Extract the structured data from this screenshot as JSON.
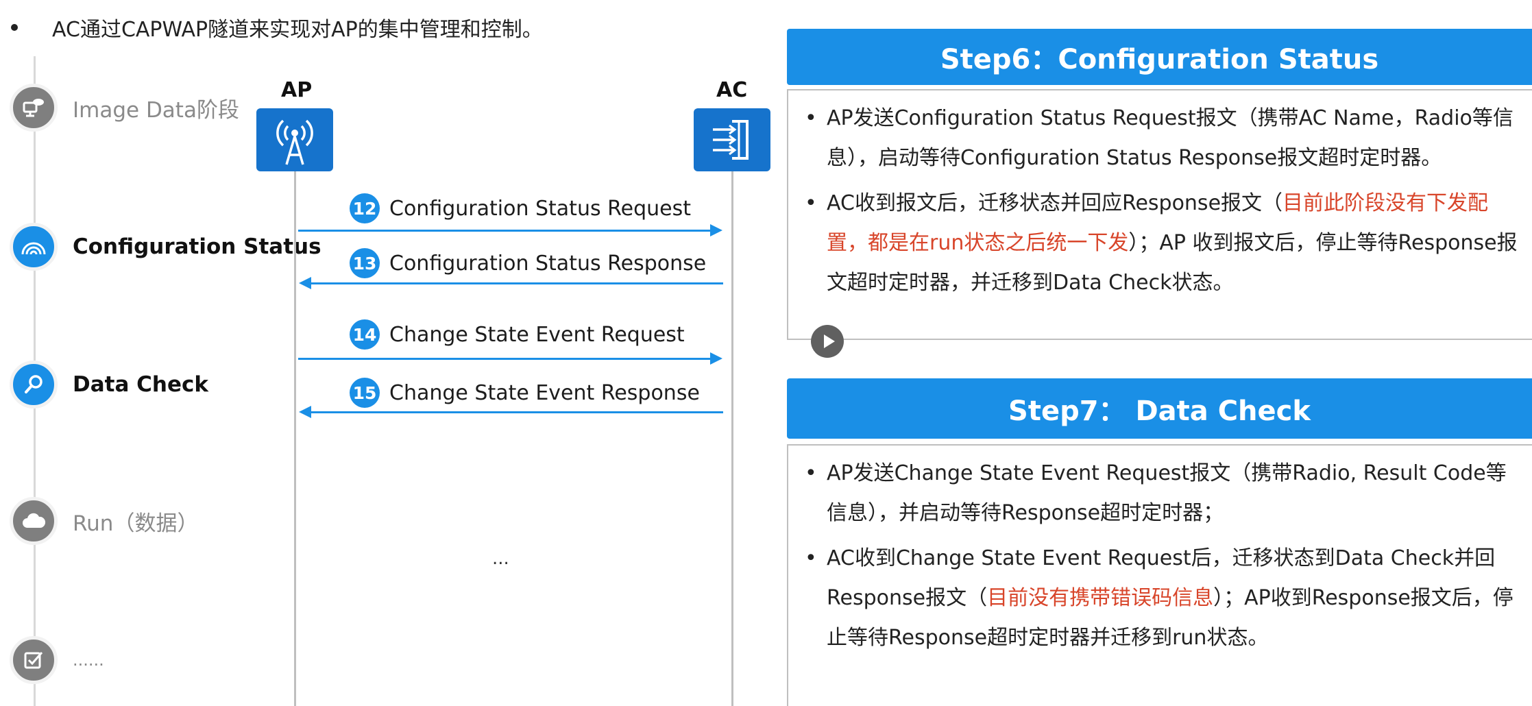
{
  "intro": "AC通过CAPWAP隧道来实现对AP的集中管理和控制。",
  "stages": [
    {
      "label": "Image Data阶段",
      "icon": "image-data-icon"
    },
    {
      "label": "Configuration Status",
      "icon": "rainbow-icon"
    },
    {
      "label": "Data Check",
      "icon": "magnifier-icon"
    },
    {
      "label": "Run（数据）",
      "icon": "cloud-icon"
    },
    {
      "label": "......",
      "icon": "checkbox-icon"
    }
  ],
  "nodes": {
    "ap": "AP",
    "ac": "AC"
  },
  "messages": [
    {
      "num": "12",
      "text": "Configuration Status Request",
      "direction": "right"
    },
    {
      "num": "13",
      "text": "Configuration Status Response",
      "direction": "left"
    },
    {
      "num": "14",
      "text": "Change State Event Request",
      "direction": "right"
    },
    {
      "num": "15",
      "text": "Change State Event Response",
      "direction": "left"
    }
  ],
  "mid_ellipsis": "...",
  "step6": {
    "title": "Step6：Configuration Status",
    "b1": "AP发送Configuration Status Request报文（携带AC Name，Radio等信息），启动等待Configuration Status Response报文超时定时器。",
    "b2_pre": "AC收到报文后，迁移状态并回应Response报文（",
    "b2_red": "目前此阶段没有下发配置，都是在run状态之后统一下发",
    "b2_post": "）；AP 收到报文后，停止等待Response报文超时定时器，并迁移到Data Check状态。"
  },
  "step7": {
    "title": "Step7： Data Check",
    "b1": "AP发送Change State Event Request报文（携带Radio, Result Code等信息），并启动等待Response超时定时器；",
    "b2_pre": "AC收到Change State Event Request后，迁移状态到Data Check并回Response报文（",
    "b2_red": "目前没有携带错误码信息",
    "b2_post": "）；AP收到Response报文后，停止等待Response超时定时器并迁移到run状态。"
  },
  "colors": {
    "accent": "#1a8fe6",
    "device": "#1673cc",
    "highlight": "#d8452a"
  }
}
